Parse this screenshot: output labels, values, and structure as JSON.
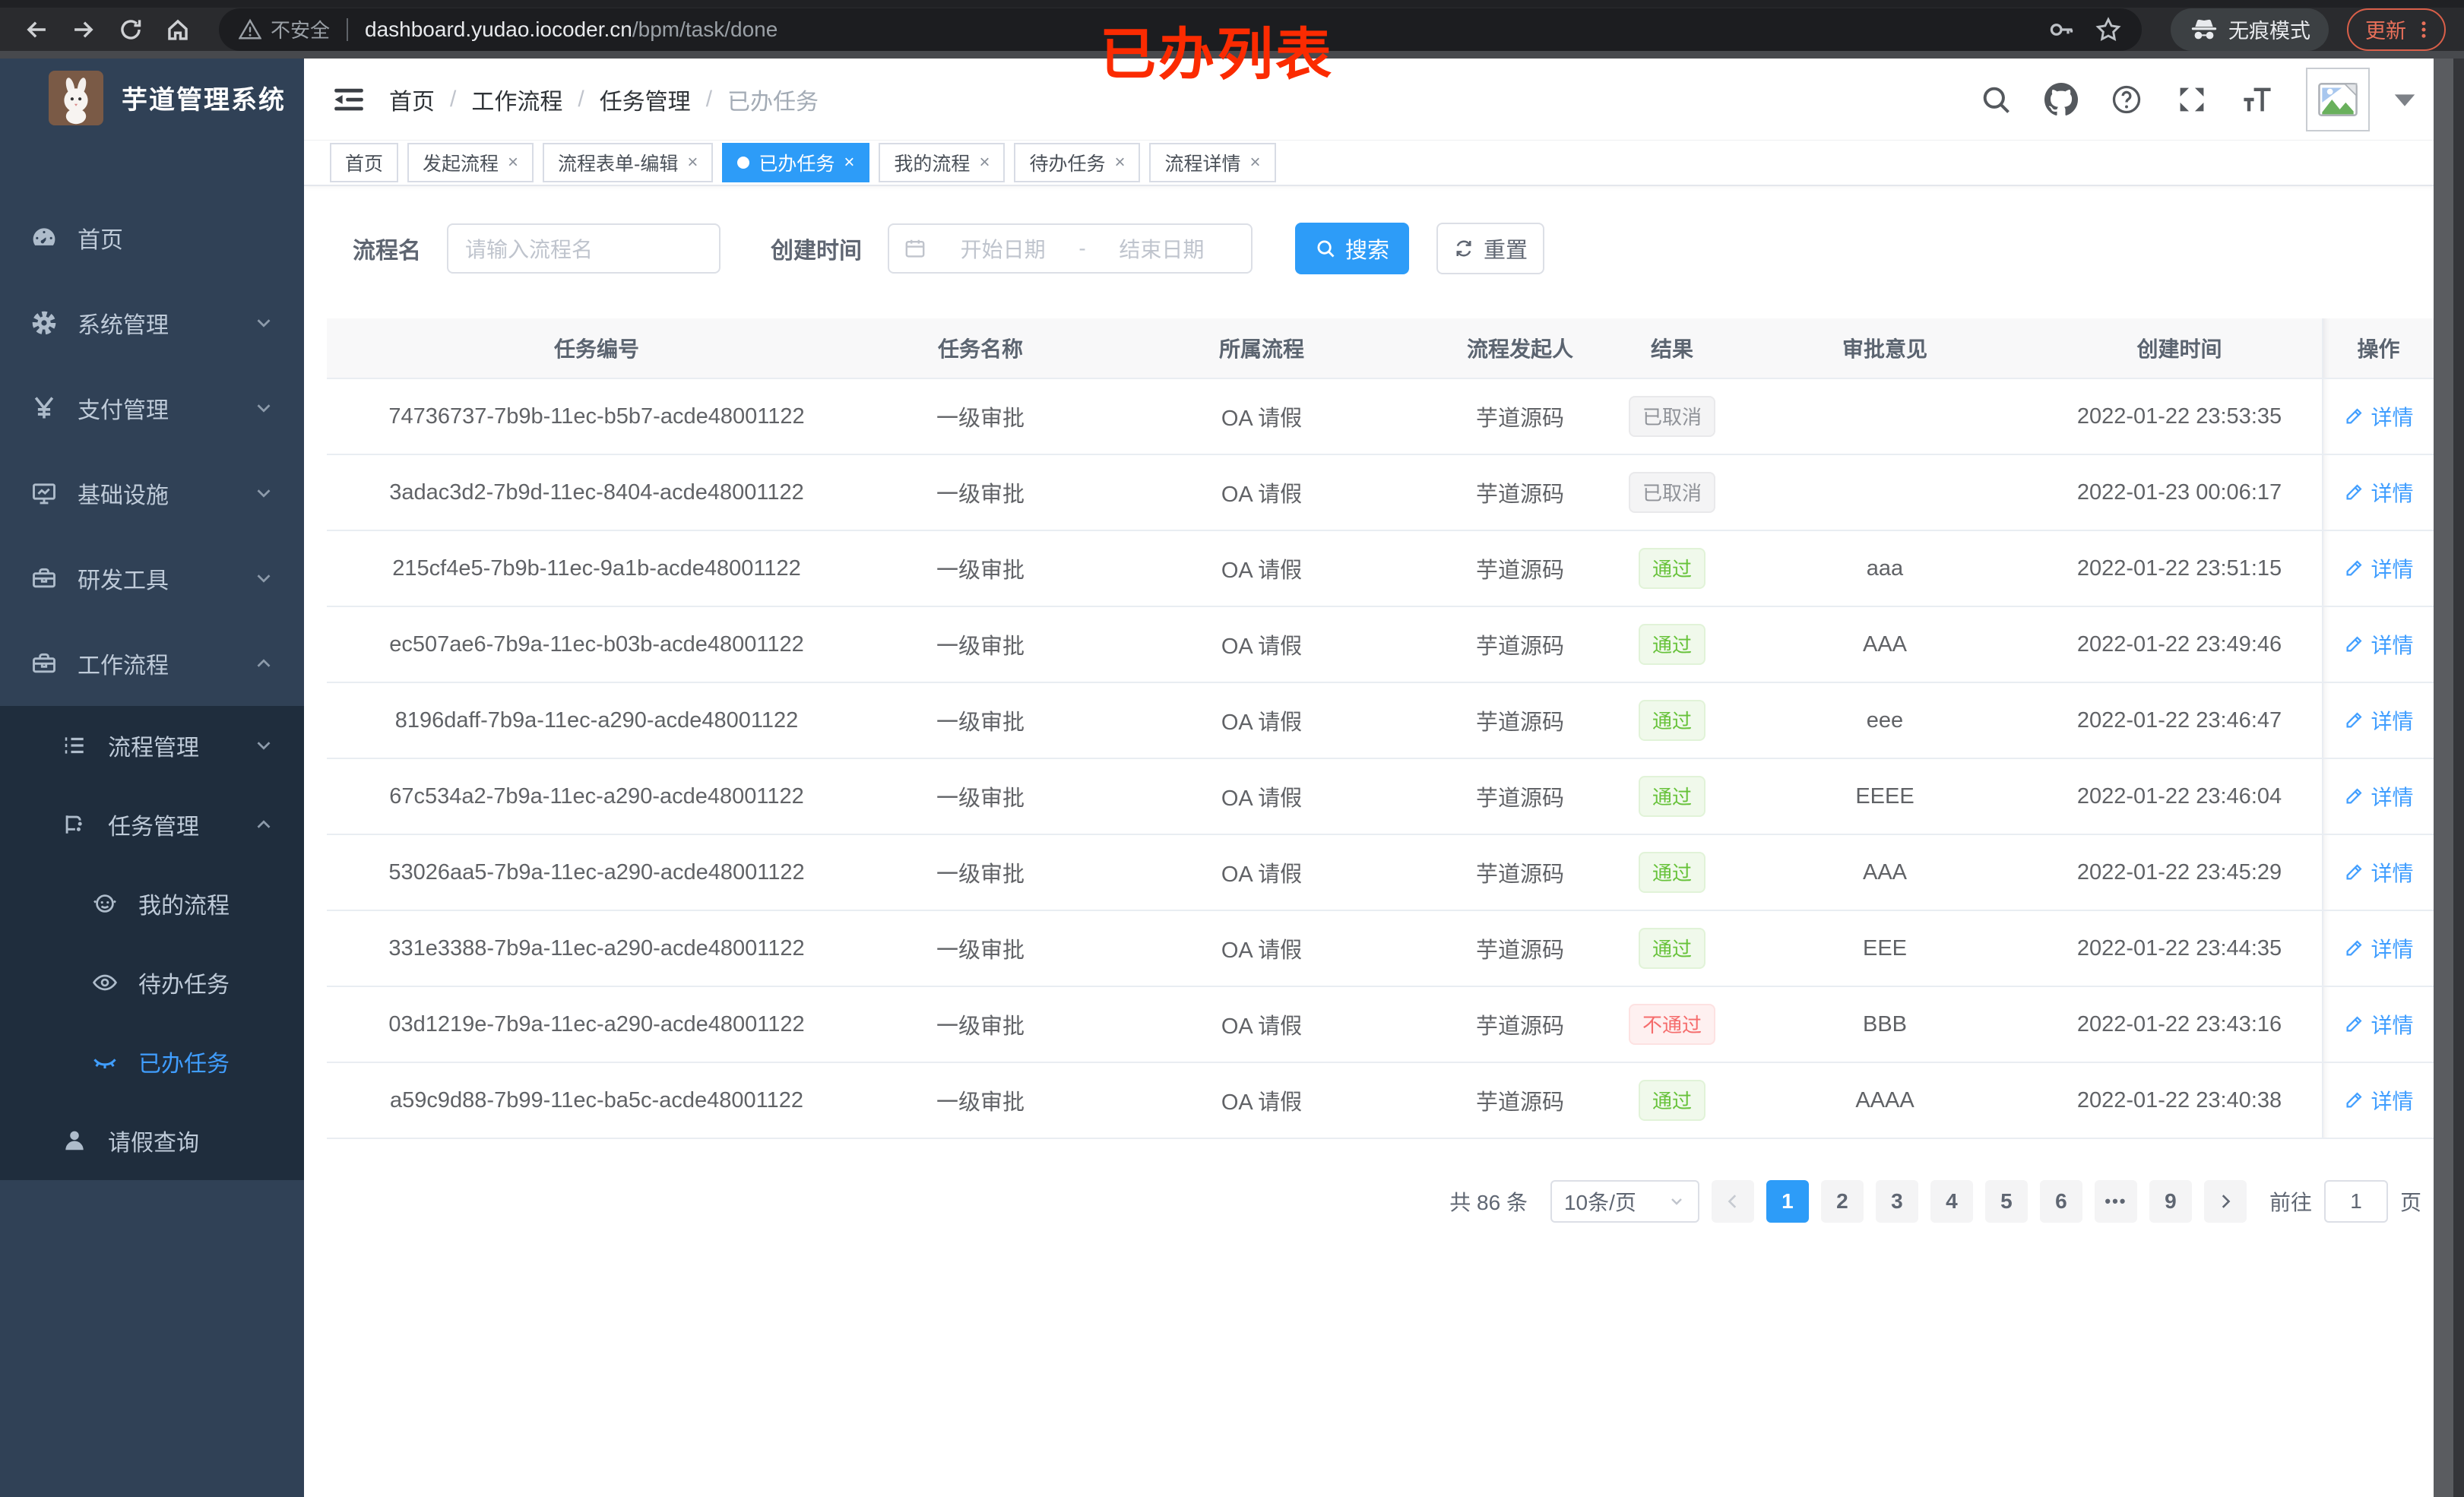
{
  "browser": {
    "insecure_label": "不安全",
    "url_host": "dashboard.yudao.iocoder.cn",
    "url_path": "/bpm/task/done",
    "incognito_label": "无痕模式",
    "update_label": "更新"
  },
  "annotation": {
    "text": "已办列表",
    "color": "#fb2b01"
  },
  "sidebar": {
    "title": "芋道管理系统",
    "items": [
      {
        "label": "首页",
        "icon": "gauge-icon",
        "level": 1,
        "sub": false,
        "active": false,
        "chevron": ""
      },
      {
        "label": "系统管理",
        "icon": "gear-icon",
        "level": 1,
        "sub": false,
        "active": false,
        "chevron": "down"
      },
      {
        "label": "支付管理",
        "icon": "yen-icon",
        "level": 1,
        "sub": false,
        "active": false,
        "chevron": "down"
      },
      {
        "label": "基础设施",
        "icon": "monitor-icon",
        "level": 1,
        "sub": false,
        "active": false,
        "chevron": "down"
      },
      {
        "label": "研发工具",
        "icon": "toolbox-icon",
        "level": 1,
        "sub": false,
        "active": false,
        "chevron": "down"
      },
      {
        "label": "工作流程",
        "icon": "briefcase-icon",
        "level": 1,
        "sub": false,
        "active": false,
        "chevron": "up"
      },
      {
        "label": "流程管理",
        "icon": "list-icon",
        "level": 2,
        "sub": true,
        "active": false,
        "chevron": "down"
      },
      {
        "label": "任务管理",
        "icon": "flow-icon",
        "level": 2,
        "sub": true,
        "active": false,
        "chevron": "up"
      },
      {
        "label": "我的流程",
        "icon": "face-icon",
        "level": 3,
        "sub": true,
        "active": false,
        "chevron": ""
      },
      {
        "label": "待办任务",
        "icon": "eye-icon",
        "level": 3,
        "sub": true,
        "active": false,
        "chevron": ""
      },
      {
        "label": "已办任务",
        "icon": "eye-closed-icon",
        "level": 3,
        "sub": true,
        "active": true,
        "chevron": ""
      },
      {
        "label": "请假查询",
        "icon": "user-icon",
        "level": 2,
        "sub": true,
        "active": false,
        "chevron": ""
      }
    ]
  },
  "header": {
    "breadcrumb": [
      "首页",
      "工作流程",
      "任务管理",
      "已办任务"
    ]
  },
  "tabs": [
    {
      "label": "首页",
      "closable": false,
      "active": false
    },
    {
      "label": "发起流程",
      "closable": true,
      "active": false
    },
    {
      "label": "流程表单-编辑",
      "closable": true,
      "active": false
    },
    {
      "label": "已办任务",
      "closable": true,
      "active": true
    },
    {
      "label": "我的流程",
      "closable": true,
      "active": false
    },
    {
      "label": "待办任务",
      "closable": true,
      "active": false
    },
    {
      "label": "流程详情",
      "closable": true,
      "active": false
    }
  ],
  "filters": {
    "name_label": "流程名",
    "name_placeholder": "请输入流程名",
    "time_label": "创建时间",
    "start_placeholder": "开始日期",
    "range_separator": "-",
    "end_placeholder": "结束日期",
    "search_label": "搜索",
    "reset_label": "重置"
  },
  "table": {
    "columns": [
      "任务编号",
      "任务名称",
      "所属流程",
      "流程发起人",
      "结果",
      "审批意见",
      "创建时间",
      "操作"
    ],
    "action_label": "详情",
    "rows": [
      {
        "id": "74736737-7b9b-11ec-b5b7-acde48001122",
        "name": "一级审批",
        "process": "OA 请假",
        "starter": "芋道源码",
        "result": "已取消",
        "result_type": "info",
        "comment": "",
        "time": "2022-01-22 23:53:35"
      },
      {
        "id": "3adac3d2-7b9d-11ec-8404-acde48001122",
        "name": "一级审批",
        "process": "OA 请假",
        "starter": "芋道源码",
        "result": "已取消",
        "result_type": "info",
        "comment": "",
        "time": "2022-01-23 00:06:17"
      },
      {
        "id": "215cf4e5-7b9b-11ec-9a1b-acde48001122",
        "name": "一级审批",
        "process": "OA 请假",
        "starter": "芋道源码",
        "result": "通过",
        "result_type": "success",
        "comment": "aaa",
        "time": "2022-01-22 23:51:15"
      },
      {
        "id": "ec507ae6-7b9a-11ec-b03b-acde48001122",
        "name": "一级审批",
        "process": "OA 请假",
        "starter": "芋道源码",
        "result": "通过",
        "result_type": "success",
        "comment": "AAA",
        "time": "2022-01-22 23:49:46"
      },
      {
        "id": "8196daff-7b9a-11ec-a290-acde48001122",
        "name": "一级审批",
        "process": "OA 请假",
        "starter": "芋道源码",
        "result": "通过",
        "result_type": "success",
        "comment": "eee",
        "time": "2022-01-22 23:46:47"
      },
      {
        "id": "67c534a2-7b9a-11ec-a290-acde48001122",
        "name": "一级审批",
        "process": "OA 请假",
        "starter": "芋道源码",
        "result": "通过",
        "result_type": "success",
        "comment": "EEEE",
        "time": "2022-01-22 23:46:04"
      },
      {
        "id": "53026aa5-7b9a-11ec-a290-acde48001122",
        "name": "一级审批",
        "process": "OA 请假",
        "starter": "芋道源码",
        "result": "通过",
        "result_type": "success",
        "comment": "AAA",
        "time": "2022-01-22 23:45:29"
      },
      {
        "id": "331e3388-7b9a-11ec-a290-acde48001122",
        "name": "一级审批",
        "process": "OA 请假",
        "starter": "芋道源码",
        "result": "通过",
        "result_type": "success",
        "comment": "EEE",
        "time": "2022-01-22 23:44:35"
      },
      {
        "id": "03d1219e-7b9a-11ec-a290-acde48001122",
        "name": "一级审批",
        "process": "OA 请假",
        "starter": "芋道源码",
        "result": "不通过",
        "result_type": "danger",
        "comment": "BBB",
        "time": "2022-01-22 23:43:16"
      },
      {
        "id": "a59c9d88-7b99-11ec-ba5c-acde48001122",
        "name": "一级审批",
        "process": "OA 请假",
        "starter": "芋道源码",
        "result": "通过",
        "result_type": "success",
        "comment": "AAAA",
        "time": "2022-01-22 23:40:38"
      }
    ]
  },
  "pagination": {
    "total_label": "共 86 条",
    "page_size": "10条/页",
    "pages": [
      "1",
      "2",
      "3",
      "4",
      "5",
      "6",
      "•••",
      "9"
    ],
    "active_page": "1",
    "goto_label": "前往",
    "goto_value": "1",
    "unit_label": "页"
  },
  "colors": {
    "accent": "#409eff",
    "success": "#67c23a",
    "danger": "#f56c6c",
    "info": "#909399",
    "sidebar_bg": "#304156",
    "submenu_bg": "#1f2d3d"
  }
}
